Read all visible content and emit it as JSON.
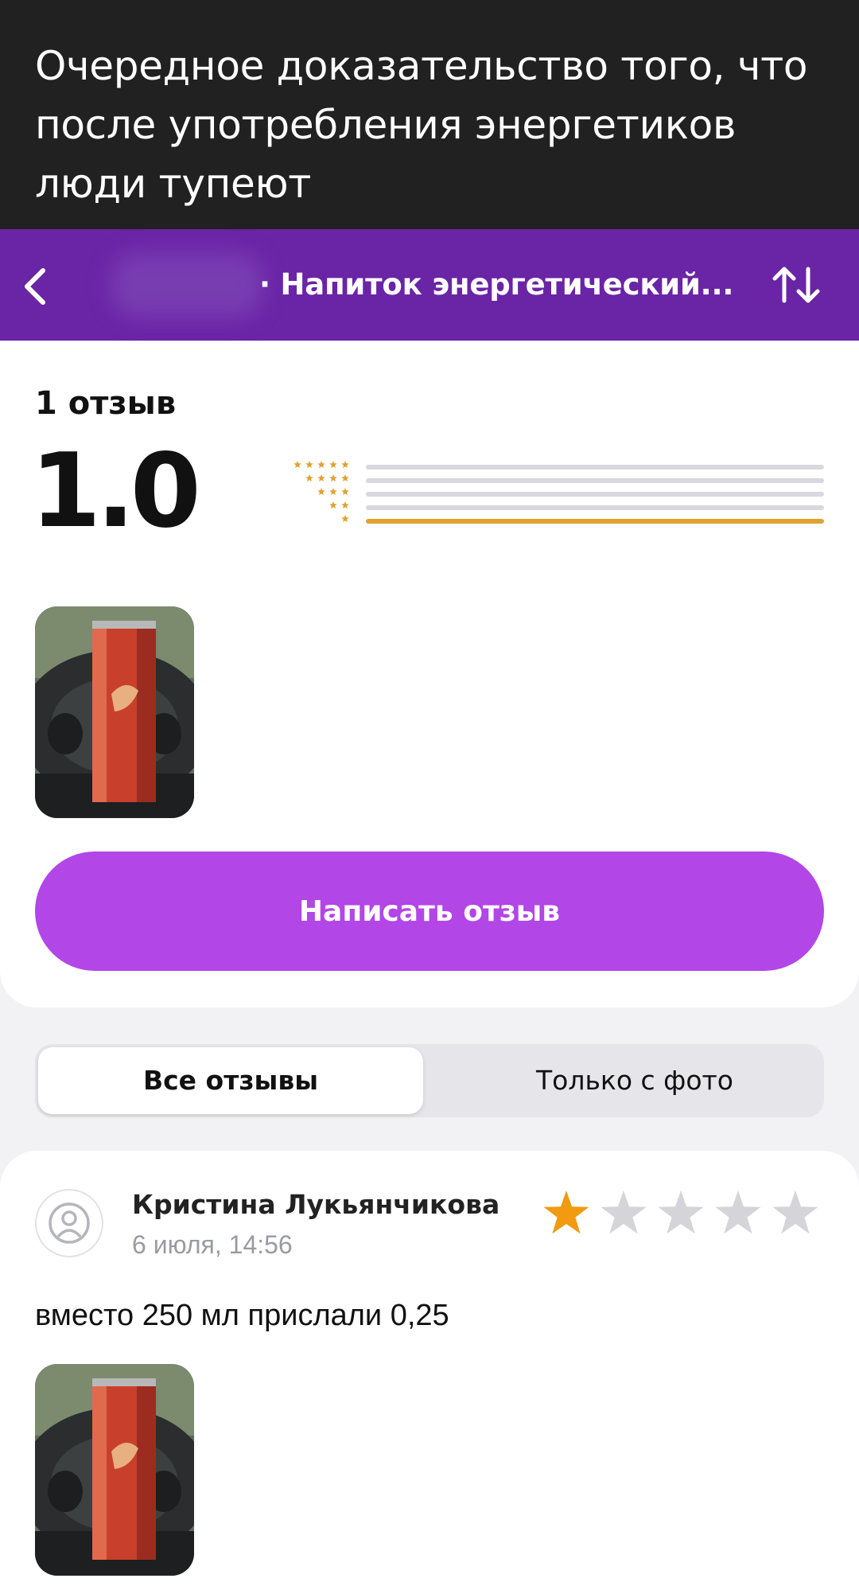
{
  "caption": {
    "line1": "Очередное доказательство того, что",
    "line2": "после употребления энергетиков",
    "line3": "люди тупеют"
  },
  "header": {
    "title": "· Напиток энергетический...",
    "back_icon": "chevron-left-icon",
    "sort_icon": "sort-arrows-icon",
    "background": "#6a24a6"
  },
  "summary": {
    "review_count": "1 отзыв",
    "average_rating": "1.0",
    "distribution": [
      {
        "stars": 5,
        "share": 0
      },
      {
        "stars": 4,
        "share": 0
      },
      {
        "stars": 3,
        "share": 0
      },
      {
        "stars": 2,
        "share": 0
      },
      {
        "stars": 1,
        "share": 1
      }
    ],
    "write_button": "Написать отзыв",
    "accent": "#b246e6",
    "star_color": "#e0a230"
  },
  "tabs": {
    "all": "Все отзывы",
    "photo_only": "Только с фото"
  },
  "review": {
    "author": "Кристина Лукьянчикова",
    "date": "6 июля, 14:56",
    "rating": 1,
    "max_rating": 5,
    "text": "вместо 250 мл прислали 0,25",
    "avatar_icon": "user-avatar-icon"
  }
}
